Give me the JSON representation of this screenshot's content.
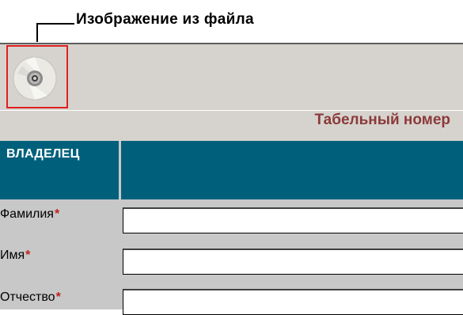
{
  "callout": {
    "title": "Изображение из файла"
  },
  "photo": {
    "icon": "cd-disc-icon",
    "frame_color": "#e02020"
  },
  "header": {
    "tab_number_label": "Табельный номер"
  },
  "section": {
    "title": "ВЛАДЕЛЕЦ",
    "color": "#00607c"
  },
  "form": {
    "required_mark": "*",
    "fields": [
      {
        "label": "Фамилия",
        "value": ""
      },
      {
        "label": "Имя",
        "value": ""
      },
      {
        "label": "Отчество",
        "value": ""
      }
    ]
  }
}
